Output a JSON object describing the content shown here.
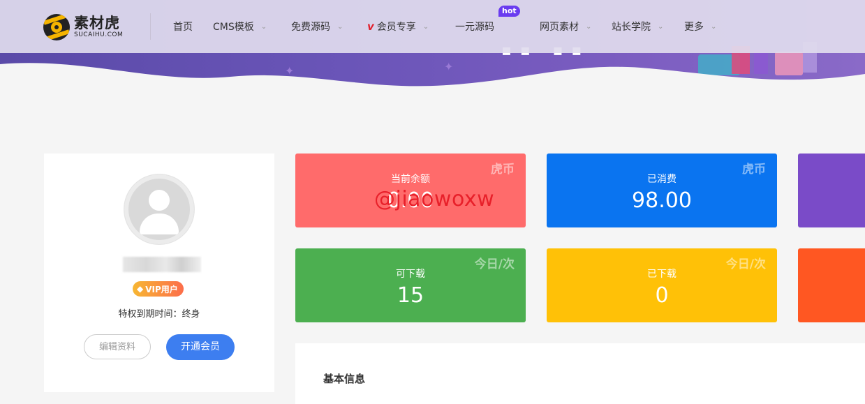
{
  "brand": {
    "name_cn": "素材虎",
    "name_en": "SUCAIHU.COM"
  },
  "nav": {
    "items": [
      {
        "label": "首页",
        "has_dropdown": false
      },
      {
        "label": "CMS模板",
        "has_dropdown": true
      },
      {
        "label": "免费源码",
        "has_dropdown": true
      },
      {
        "label": "会员专享",
        "has_dropdown": true,
        "prefix": "v"
      },
      {
        "label": "一元源码",
        "has_dropdown": false,
        "badge": "hot"
      },
      {
        "label": "网页素材",
        "has_dropdown": true
      },
      {
        "label": "站长学院",
        "has_dropdown": true
      },
      {
        "label": "更多",
        "has_dropdown": true
      }
    ]
  },
  "profile": {
    "vip_label": "VIP用户",
    "expiry_text": "特权到期时间：终身",
    "edit_button": "编辑资料",
    "upgrade_button": "开通会员"
  },
  "stats": {
    "balance": {
      "label": "当前余额",
      "value": "0.00",
      "tag": "虎币",
      "color": "#ff6b6b"
    },
    "spent": {
      "label": "已消费",
      "value": "98.00",
      "tag": "虎币",
      "color": "#0a74f0"
    },
    "can_download": {
      "label": "可下载",
      "value": "15",
      "tag": "今日/次",
      "color": "#4caf50"
    },
    "downloaded": {
      "label": "已下载",
      "value": "0",
      "tag": "今日/次",
      "color": "#ffc107"
    }
  },
  "watermark": "@jiaowoxw",
  "info_panel": {
    "title": "基本信息"
  },
  "colors": {
    "accent": "#3d7ef0",
    "purple_card": "#7a4bc8",
    "orange_card": "#ff5722",
    "hot_badge": "#6a3cf0"
  }
}
